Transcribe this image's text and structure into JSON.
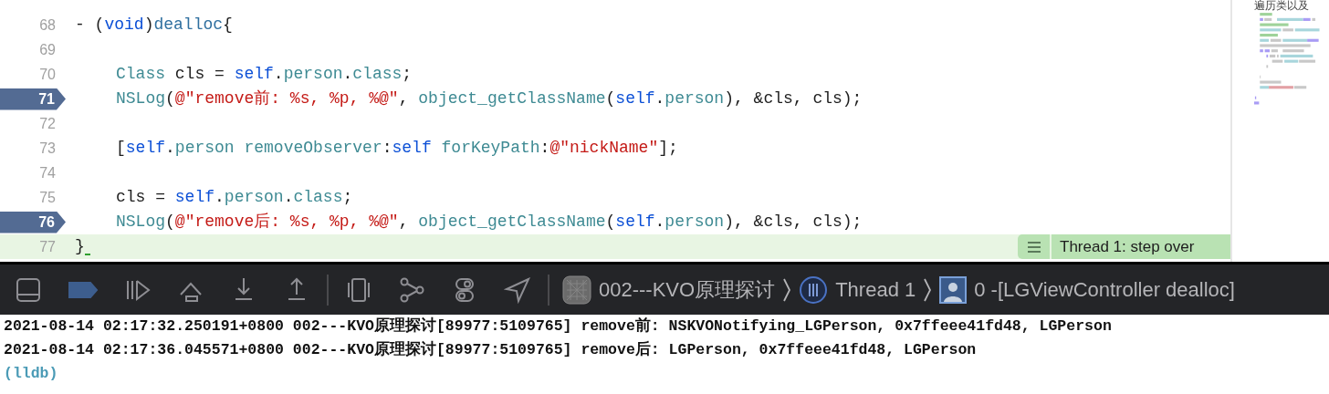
{
  "editor": {
    "lines": [
      {
        "number": "68",
        "indented": false,
        "breakpoint": false,
        "current": false,
        "tokens": [
          {
            "kind": "plain",
            "text": "- ("
          },
          {
            "kind": "keyword",
            "text": "void"
          },
          {
            "kind": "plain",
            "text": ")"
          },
          {
            "kind": "method",
            "text": "dealloc"
          },
          {
            "kind": "plain",
            "text": "{"
          }
        ]
      },
      {
        "number": "69",
        "breakpoint": false,
        "current": false
      },
      {
        "number": "70",
        "indented": true,
        "breakpoint": false,
        "current": false,
        "tokens": [
          {
            "kind": "type",
            "text": "Class"
          },
          {
            "kind": "plain",
            "text": " cls = "
          },
          {
            "kind": "keyword",
            "text": "self"
          },
          {
            "kind": "plain",
            "text": "."
          },
          {
            "kind": "type",
            "text": "person"
          },
          {
            "kind": "plain",
            "text": "."
          },
          {
            "kind": "type",
            "text": "class"
          },
          {
            "kind": "plain",
            "text": ";"
          }
        ]
      },
      {
        "number": "71",
        "indented": true,
        "breakpoint": true,
        "current": false,
        "tokens": [
          {
            "kind": "type",
            "text": "NSLog"
          },
          {
            "kind": "plain",
            "text": "("
          },
          {
            "kind": "string",
            "text": "@\"remove前: %s, %p, %@\""
          },
          {
            "kind": "plain",
            "text": ", "
          },
          {
            "kind": "type",
            "text": "object_getClassName"
          },
          {
            "kind": "plain",
            "text": "("
          },
          {
            "kind": "keyword",
            "text": "self"
          },
          {
            "kind": "plain",
            "text": "."
          },
          {
            "kind": "type",
            "text": "person"
          },
          {
            "kind": "plain",
            "text": "), &cls, cls);"
          }
        ]
      },
      {
        "number": "72",
        "breakpoint": false,
        "current": false
      },
      {
        "number": "73",
        "indented": true,
        "breakpoint": false,
        "current": false,
        "tokens": [
          {
            "kind": "plain",
            "text": "["
          },
          {
            "kind": "keyword",
            "text": "self"
          },
          {
            "kind": "plain",
            "text": "."
          },
          {
            "kind": "type",
            "text": "person "
          },
          {
            "kind": "type",
            "text": "removeObserver"
          },
          {
            "kind": "plain",
            "text": ":"
          },
          {
            "kind": "keyword",
            "text": "self "
          },
          {
            "kind": "type",
            "text": "forKeyPath"
          },
          {
            "kind": "plain",
            "text": ":"
          },
          {
            "kind": "string",
            "text": "@\"nickName\""
          },
          {
            "kind": "plain",
            "text": "];"
          }
        ]
      },
      {
        "number": "74",
        "breakpoint": false,
        "current": false
      },
      {
        "number": "75",
        "indented": true,
        "breakpoint": false,
        "current": false,
        "tokens": [
          {
            "kind": "plain",
            "text": "cls = "
          },
          {
            "kind": "keyword",
            "text": "self"
          },
          {
            "kind": "plain",
            "text": "."
          },
          {
            "kind": "type",
            "text": "person"
          },
          {
            "kind": "plain",
            "text": "."
          },
          {
            "kind": "type",
            "text": "class"
          },
          {
            "kind": "plain",
            "text": ";"
          }
        ]
      },
      {
        "number": "76",
        "indented": true,
        "breakpoint": true,
        "current": false,
        "tokens": [
          {
            "kind": "type",
            "text": "NSLog"
          },
          {
            "kind": "plain",
            "text": "("
          },
          {
            "kind": "string",
            "text": "@\"remove后: %s, %p, %@\""
          },
          {
            "kind": "plain",
            "text": ", "
          },
          {
            "kind": "type",
            "text": "object_getClassName"
          },
          {
            "kind": "plain",
            "text": "("
          },
          {
            "kind": "keyword",
            "text": "self"
          },
          {
            "kind": "plain",
            "text": "."
          },
          {
            "kind": "type",
            "text": "person"
          },
          {
            "kind": "plain",
            "text": "), &cls, cls);"
          }
        ]
      },
      {
        "number": "77",
        "indented": false,
        "breakpoint": false,
        "current": true,
        "tokens": [
          {
            "kind": "plain",
            "text": "}"
          }
        ]
      }
    ],
    "annotation": "Thread 1: step over",
    "minimap_title": "遍历类以及"
  },
  "debug_bar": {
    "breakpoints_active": true,
    "breadcrumbs": [
      "002---KVO原理探讨",
      "Thread 1",
      "0 -[LGViewController dealloc]"
    ]
  },
  "console": {
    "lines": [
      {
        "kind": "output",
        "text": "2021-08-14 02:17:32.250191+0800 002---KVO原理探讨[89977:5109765] remove前: NSKVONotifying_LGPerson, 0x7ffeee41fd48, LGPerson"
      },
      {
        "kind": "output",
        "text": "2021-08-14 02:17:36.045571+0800 002---KVO原理探讨[89977:5109765] remove后: LGPerson, 0x7ffeee41fd48, LGPerson"
      },
      {
        "kind": "prompt",
        "text": "(lldb)"
      }
    ]
  }
}
